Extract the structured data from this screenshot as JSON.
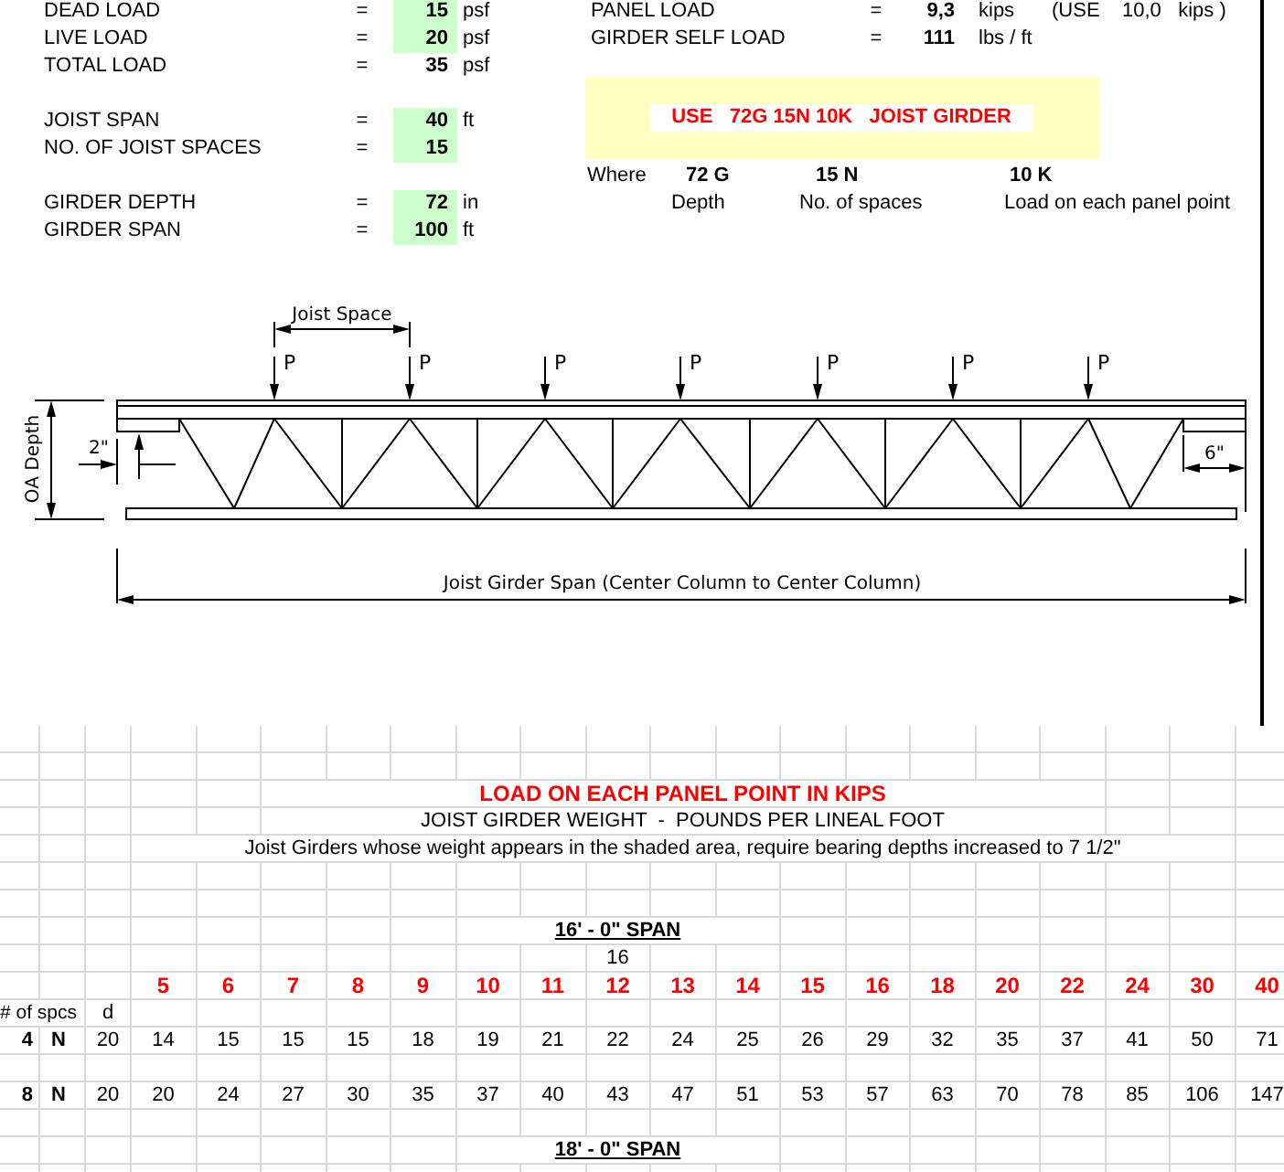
{
  "inputs": [
    [
      {
        "label": "DEAD LOAD",
        "equals": "=",
        "value": "15",
        "unit": "psf",
        "kind": "input"
      },
      {
        "label": "LIVE LOAD",
        "equals": "=",
        "value": "20",
        "unit": "psf",
        "kind": "input"
      },
      {
        "label": "TOTAL LOAD",
        "equals": "=",
        "value": "35",
        "unit": "psf",
        "kind": "computed"
      }
    ],
    [
      {
        "label": "JOIST SPAN",
        "equals": "=",
        "value": "40",
        "unit": "ft",
        "kind": "input"
      },
      {
        "label": "NO. OF JOIST SPACES",
        "equals": "=",
        "value": "15",
        "kind": "input"
      }
    ],
    [
      {
        "label": "GIRDER DEPTH",
        "equals": "=",
        "value": "72",
        "unit": "in",
        "kind": "input"
      },
      {
        "label": "GIRDER SPAN",
        "equals": "=",
        "value": "100",
        "unit": "ft",
        "kind": "input"
      }
    ]
  ],
  "results": [
    {
      "label": "PANEL LOAD",
      "equals": "=",
      "value": "9,3",
      "unit": "kips",
      "note": "(USE    10,0   kips )"
    },
    {
      "label": "GIRDER SELF LOAD",
      "equals": "=",
      "value": "111",
      "unit": "lbs / ft"
    }
  ],
  "designation": "USE   72G 15N 10K   JOIST GIRDER",
  "legend": {
    "label": "Where",
    "parts": [
      {
        "code": "72 G",
        "meaning": "Depth"
      },
      {
        "code": "15 N",
        "meaning": "No. of spaces"
      },
      {
        "code": "10 K",
        "meaning": "Load on each panel point"
      }
    ]
  },
  "diagram": {
    "joist_space_label": "Joist Space",
    "load_labels": [
      "P",
      "P",
      "P",
      "P",
      "P",
      "P",
      "P"
    ],
    "depth_label": "OA Depth",
    "bearing_label": "2\"",
    "seat_label": "6\"",
    "span_label": "Joist Girder Span (Center Column to Center Column)"
  },
  "table": {
    "title": "LOAD ON EACH PANEL POINT IN KIPS",
    "subtitle": "JOIST GIRDER WEIGHT  -  POUNDS PER LINEAL FOOT",
    "note": "Joist Girders whose weight appears in the shaded area, require bearing depths increased to 7 1/2\"",
    "sections": [
      {
        "span": "16' - 0\" SPAN",
        "span_value": "16",
        "loads": [
          "5",
          "6",
          "7",
          "8",
          "9",
          "10",
          "11",
          "12",
          "13",
          "14",
          "15",
          "16",
          "18",
          "20",
          "22",
          "24",
          "30",
          "40"
        ],
        "spaces_header": "# of spcs",
        "depth_header": "d",
        "rows": [
          {
            "spaces": "4",
            "n": "N",
            "d": "20",
            "values": [
              "14",
              "15",
              "15",
              "15",
              "18",
              "19",
              "21",
              "22",
              "24",
              "25",
              "26",
              "29",
              "32",
              "35",
              "37",
              "41",
              "50",
              "71"
            ]
          },
          {
            "spaces": "8",
            "n": "N",
            "d": "20",
            "values": [
              "20",
              "24",
              "27",
              "30",
              "35",
              "37",
              "40",
              "43",
              "47",
              "51",
              "53",
              "57",
              "63",
              "70",
              "78",
              "85",
              "106",
              "147"
            ]
          }
        ]
      },
      {
        "span": "18' - 0\" SPAN"
      }
    ]
  }
}
